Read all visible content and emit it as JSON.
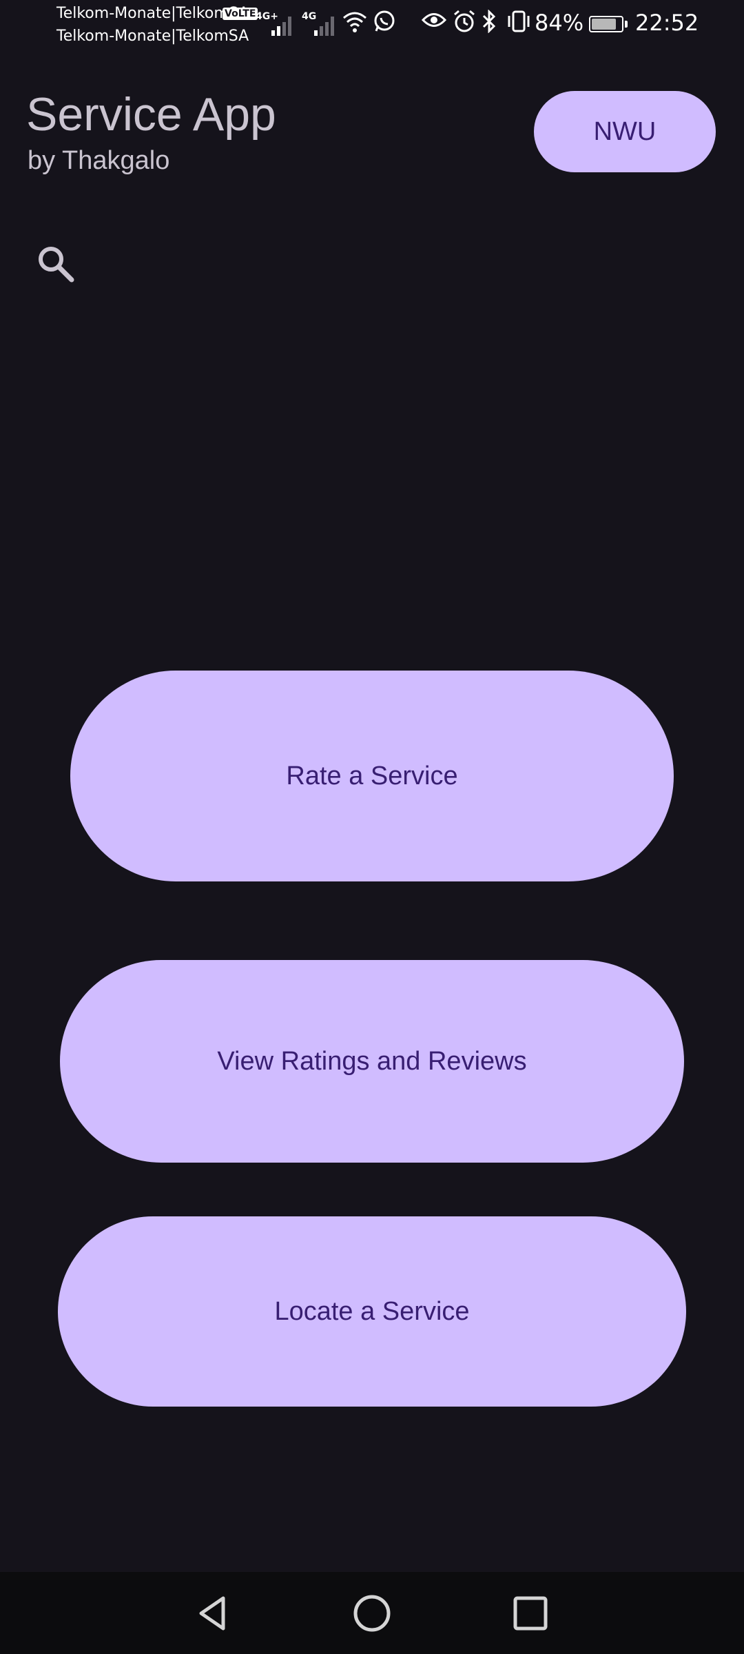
{
  "status_bar": {
    "carrier_line1": "Telkom-Monate|TelkomSA",
    "carrier_line2": "Telkom-Monate|TelkomSA",
    "volte": "VoLTE",
    "network1": "4G+",
    "network2": "4G",
    "battery_percent": "84%",
    "battery_level": 0.84,
    "time": "22:52"
  },
  "header": {
    "title": "Service App",
    "subtitle": "by Thakgalo",
    "nwu_label": "NWU"
  },
  "main": {
    "rate_label": "Rate a Service",
    "view_label": "View Ratings and Reviews",
    "locate_label": "Locate a Service"
  },
  "colors": {
    "background": "#15131b",
    "button_bg": "#d0bcff",
    "button_text": "#381e72",
    "title_text": "#cac4d0",
    "nav_bar": "#0c0c0e"
  },
  "icons": {
    "search": "search-icon",
    "back": "back-icon",
    "home": "home-icon",
    "recents": "recents-icon"
  }
}
